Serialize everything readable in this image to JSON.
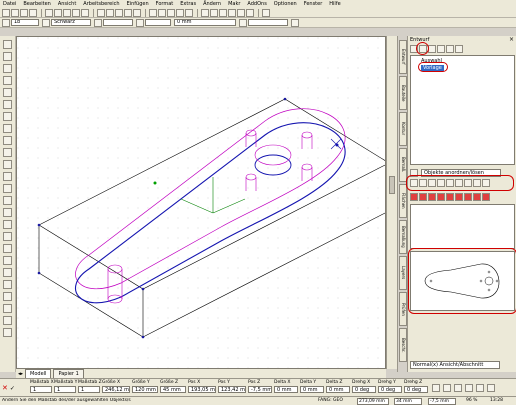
{
  "menu": [
    "Datei",
    "Bearbeiten",
    "Ansicht",
    "Arbeitsbereich",
    "Einfügen",
    "Format",
    "Extras",
    "Ändern",
    "Makr",
    "AddOns",
    "Optionen",
    "Fenster",
    "Hilfe"
  ],
  "toolbar2": {
    "linewidth": "1b",
    "color": "Schwarz",
    "dim": "0 mm"
  },
  "panel_top": {
    "title": "Entwurf",
    "tree_item_1": "Auswahl",
    "tree_item_2": "Vorlage"
  },
  "panel_mid": {
    "dropdown": "Objekte anordnen/lösen"
  },
  "panel_bottom": {
    "dropdown": "Normal(x) Ansicht/Abschnitt"
  },
  "side_tabs": [
    "Entwurf",
    "Bauteile",
    "Kontur",
    "Bemaß.",
    "Flächen",
    "Bemaßung",
    "Layers",
    "Prüfen",
    "Beschr.",
    "Symb."
  ],
  "drawing_tabs": [
    "Modell",
    "Papier 1"
  ],
  "coord_headers": [
    "Maßstab X",
    "Maßstab Y",
    "Maßstab Z",
    "Größe X",
    "Größe Y",
    "Größe Z",
    "Pos X",
    "Pos Y",
    "Pos Z",
    "Delta X",
    "Delta Y",
    "Delta Z",
    "Drehg X",
    "Drehg Y",
    "Drehg Z"
  ],
  "coord_values": [
    "1",
    "1",
    "1",
    "246,12 mm",
    "120 mm",
    "45 mm",
    "193,05 mm",
    "123,42 mm",
    "-7,5 mm",
    "0 mm",
    "0 mm",
    "0 mm",
    "0 deg",
    "0 deg",
    "0 deg"
  ],
  "status": {
    "message": "Ändern Sie den Maßstab des/der ausgewählten Objekts/s",
    "mode": "FANG: GEO",
    "coord1": "273,09 mm",
    "coord2": "34 mm",
    "coord3": "-7,5 mm",
    "zoom": "96 %",
    "time": "13:28"
  }
}
